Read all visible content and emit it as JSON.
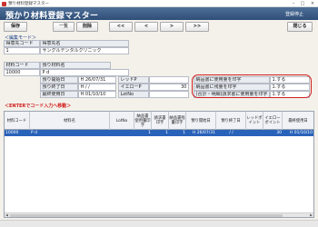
{
  "os_window": {
    "title": "預り材料登録マスター",
    "minimize": "–",
    "maximize": "□",
    "close": "×"
  },
  "header": {
    "title": "預かり材料登録マスター",
    "mode": "登録停止"
  },
  "toolbar": {
    "save": "保存",
    "list": "一覧",
    "delete": "削除",
    "first": "<<",
    "prev": "<",
    "next": ">",
    "last": ">>",
    "close": "閉じる"
  },
  "edit_section_label": "＜編集モード＞",
  "form": {
    "customer_code_label": "得意先コード",
    "customer_code": "1",
    "customer_name_label": "得意先名",
    "customer_name": "サングルデンタルクリニック",
    "material_code_label": "材料コード",
    "material_code": "10000",
    "material_name_label": "預り材料名",
    "material_name": "P d",
    "start_date_label": "預り開始日",
    "start_date": "H 26/07/31",
    "end_date_label": "預り終了日",
    "end_date": "H  /  /",
    "last_used_label": "最終使用日",
    "last_used": "H 01/10/10",
    "red_label": "レッドP",
    "red_value": "",
    "yellow_label": "イエローP",
    "yellow_value": "30",
    "lot_label": "LotNo",
    "lot_value": "",
    "opt1_label": "納品書に使用量を印字",
    "opt1_value": "1.する",
    "opt2_label": "納品書に残量を印字",
    "opt2_value": "1.する",
    "opt3_label": "(合計・明細)請求書に使用量を印字",
    "opt3_value": "1.する"
  },
  "enter_hint": "＜ENTERでコード入力へ移動＞",
  "grid": {
    "columns": [
      "材料コード",
      "材料名",
      "LotNo",
      "納品書\n使用量印字",
      "請求書\n印字",
      "納品書残\n量印字",
      "預り開始日",
      "預り終了日",
      "レッドポ\nイント",
      "イエロー\nポイント",
      "最終使用日"
    ],
    "rows": [
      [
        "10000",
        "P d",
        "",
        "1",
        "1",
        "1",
        "H 26/07/31",
        "/  /",
        "",
        "30",
        "H 01/10/10"
      ]
    ]
  },
  "colors": {
    "header_bar": "#3a5a86",
    "selected_row": "#2962b9",
    "highlight_oval": "#d11f1f"
  }
}
